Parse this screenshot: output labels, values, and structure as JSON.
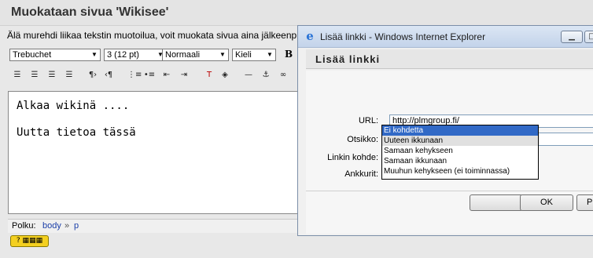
{
  "page": {
    "title": "Muokataan sivua 'Wikisee'",
    "hint": "Älä murehdi liikaa tekstin muotoilua, voit muokata sivua aina jälkeenp"
  },
  "toolbar": {
    "font_family": "Trebuchet",
    "font_size": "3 (12 pt)",
    "style": "Normaali",
    "language": "Kieli",
    "bold": "B",
    "icons": [
      "align-left-icon",
      "align-center-icon",
      "align-right-icon",
      "align-justify-icon",
      "ltr-icon",
      "rtl-icon",
      "ordered-list-icon",
      "unordered-list-icon",
      "outdent-icon",
      "indent-icon",
      "text-color-icon",
      "bg-color-icon",
      "horizontal-rule-icon",
      "anchor-icon",
      "link-icon"
    ]
  },
  "editor": {
    "line1": "Alkaa wikinä ....",
    "line2": "Uutta tietoa tässä"
  },
  "statusbar": {
    "path_label": "Polku:",
    "crumb1": "body",
    "separator": "»",
    "crumb2": "p"
  },
  "dialog": {
    "window_title": "Lisää linkki - Windows Internet Explorer",
    "header": "Lisää linkki",
    "url_label": "URL:",
    "url_value": "http://plmgroup.fi/",
    "title_label": "Otsikko:",
    "title_value": "",
    "target_label": "Linkin kohde:",
    "anchor_label": "Ankkurit:",
    "ok_label": "OK",
    "cancel_label": "P",
    "target_options": [
      "Ei kohdetta",
      "Uuteen ikkunaan",
      "Samaan kehykseen",
      "Samaan ikkunaan",
      "Muuhun kehykseen (ei toiminnassa)"
    ],
    "selected_target_index": 0
  },
  "colors": {
    "selection": "#3169c6",
    "titlebar": "#c3d3ea",
    "keyboard_button": "#f4d020"
  }
}
